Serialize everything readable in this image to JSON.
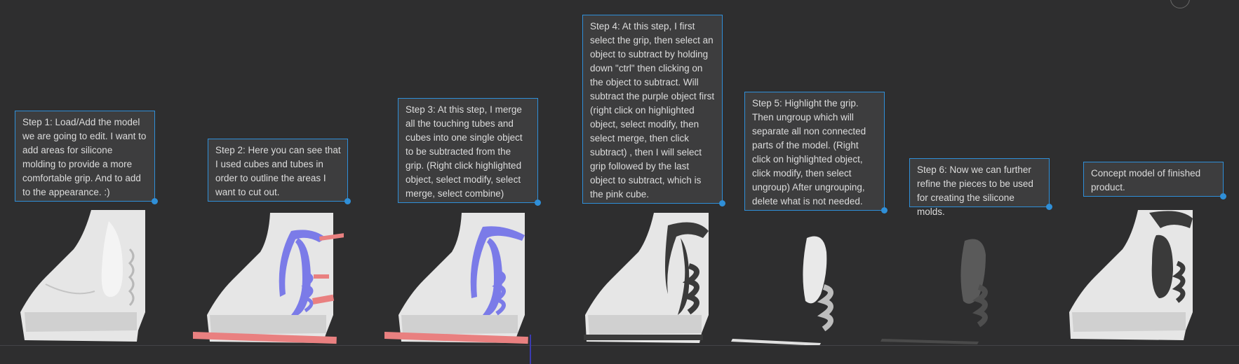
{
  "steps": [
    {
      "text": "Step 1: Load/Add the model we are going to edit.  I want to add areas for silicone molding to provide a more comfortable grip.  And to add to the appearance. :)"
    },
    {
      "text": "Step 2: Here you can see that I used cubes and tubes in order to outline the areas I want to cut out."
    },
    {
      "text": "Step 3: At this step, I merge all the touching tubes and cubes into one single object to be subtracted from the grip. (Right click highlighted object, select modify, select merge, select combine)"
    },
    {
      "text": "Step 4: At this step, I first select the grip, then select an object to subtract by holding down \"ctrl\" then clicking on the object to subtract.  Will subtract the purple object first (right click on highlighted object, select modify, then select merge, then click subtract) , then I will select grip followed by the last object to subtract, which is the pink cube."
    },
    {
      "text": "Step 5:  Highlight the grip. Then ungroup which will separate all non connected parts of the model. (Right click on highlighted object, click modify, then select ungroup) After ungrouping, delete what is not needed."
    },
    {
      "text": "Step 6: Now we can further refine the pieces to be used for creating the silicone molds."
    },
    {
      "text": "Concept model of finished product."
    }
  ],
  "colors": {
    "background": "#2e2e2f",
    "note_bg": "#3d3d3e",
    "note_border": "#2f8fd8",
    "grip": "#e9e9e9",
    "cutout_purple": "#7b7be8",
    "cube_pink": "#e98080",
    "subtracted_dark": "#3a3a3a"
  }
}
